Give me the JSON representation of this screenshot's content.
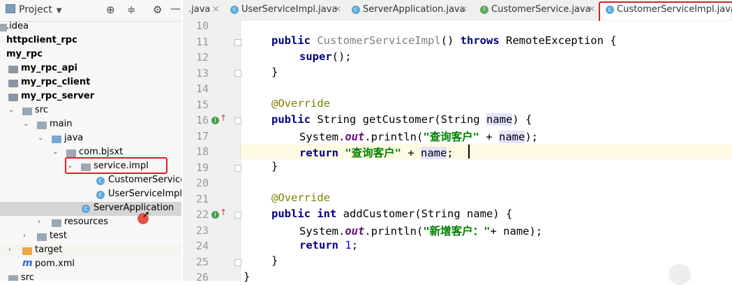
{
  "project": {
    "title": "Project",
    "tree": [
      {
        "label": ".idea",
        "icon": "folder-icon",
        "bold": false
      },
      {
        "label": "httpclient_rpc",
        "icon": "module-icon",
        "bold": true
      },
      {
        "label": "my_rpc",
        "icon": "module-icon",
        "bold": true
      },
      {
        "label": "my_rpc_api",
        "icon": "module-icon",
        "bold": true
      },
      {
        "label": "my_rpc_client",
        "icon": "module-icon",
        "bold": true
      },
      {
        "label": "my_rpc_server",
        "icon": "module-icon",
        "bold": true
      },
      {
        "label": "src",
        "icon": "folder-icon",
        "bold": false
      },
      {
        "label": "main",
        "icon": "folder-icon",
        "bold": false
      },
      {
        "label": "java",
        "icon": "source-folder-icon",
        "bold": false
      },
      {
        "label": "com.bjsxt",
        "icon": "package-icon",
        "bold": false
      },
      {
        "label": "service.impl",
        "icon": "package-icon",
        "bold": false
      },
      {
        "label": "CustomerServiceIm",
        "icon": "class-icon",
        "bold": false
      },
      {
        "label": "UserServiceImpl",
        "icon": "class-icon",
        "bold": false
      },
      {
        "label": "ServerApplication",
        "icon": "class-icon",
        "bold": false
      },
      {
        "label": "resources",
        "icon": "resources-folder-icon",
        "bold": false
      },
      {
        "label": "test",
        "icon": "folder-icon",
        "bold": false
      },
      {
        "label": "target",
        "icon": "target-folder-icon",
        "bold": false
      },
      {
        "label": "pom.xml",
        "icon": "maven-icon",
        "bold": false
      },
      {
        "label": "src",
        "icon": "folder-icon",
        "bold": false
      }
    ]
  },
  "tabs": [
    {
      "label": ".java",
      "icon": ""
    },
    {
      "label": "UserServiceImpl.java",
      "icon": "class-icon"
    },
    {
      "label": "ServerApplication.java",
      "icon": "class-icon"
    },
    {
      "label": "CustomerService.java",
      "icon": "interface-icon"
    },
    {
      "label": "CustomerServiceImpl.java",
      "icon": "class-icon"
    }
  ],
  "editor": {
    "line_numbers": [
      "10",
      "11",
      "12",
      "13",
      "14",
      "15",
      "16",
      "17",
      "18",
      "19",
      "20",
      "21",
      "22",
      "23",
      "24",
      "25",
      "26"
    ],
    "lines": {
      "l11": {
        "kw1": "public",
        "ctor": "CustomerServiceImpl",
        "paren": "() ",
        "kw2": "throws",
        "rest": " RemoteException {"
      },
      "l12": {
        "kw": "super",
        "rest": "();"
      },
      "l13": "}",
      "l15": "@Override",
      "l16": {
        "kw": "public",
        "a": " String getCustomer(String ",
        "param": "name",
        "b": ") {"
      },
      "l17": {
        "a": "System.",
        "fld": "out",
        "b": ".println(",
        "str": "\"查询客户\"",
        "c": " + ",
        "param": "name",
        "d": ");"
      },
      "l18": {
        "kw": "return",
        "sp": " ",
        "str": "\"查询客户\"",
        "c": " + ",
        "param": "name",
        "d": ";"
      },
      "l19": "}",
      "l21": "@Override",
      "l22": {
        "kw1": "public",
        "sp": " ",
        "kw2": "int",
        "rest": " addCustomer(String name) {"
      },
      "l23": {
        "a": "System.",
        "fld": "out",
        "b": ".println(",
        "str": "\"新增客户：\"",
        "c": "+ name);"
      },
      "l24": {
        "kw": "return",
        "sp": " ",
        "num": "1",
        "d": ";"
      },
      "l25": "}",
      "l26": "}"
    }
  }
}
